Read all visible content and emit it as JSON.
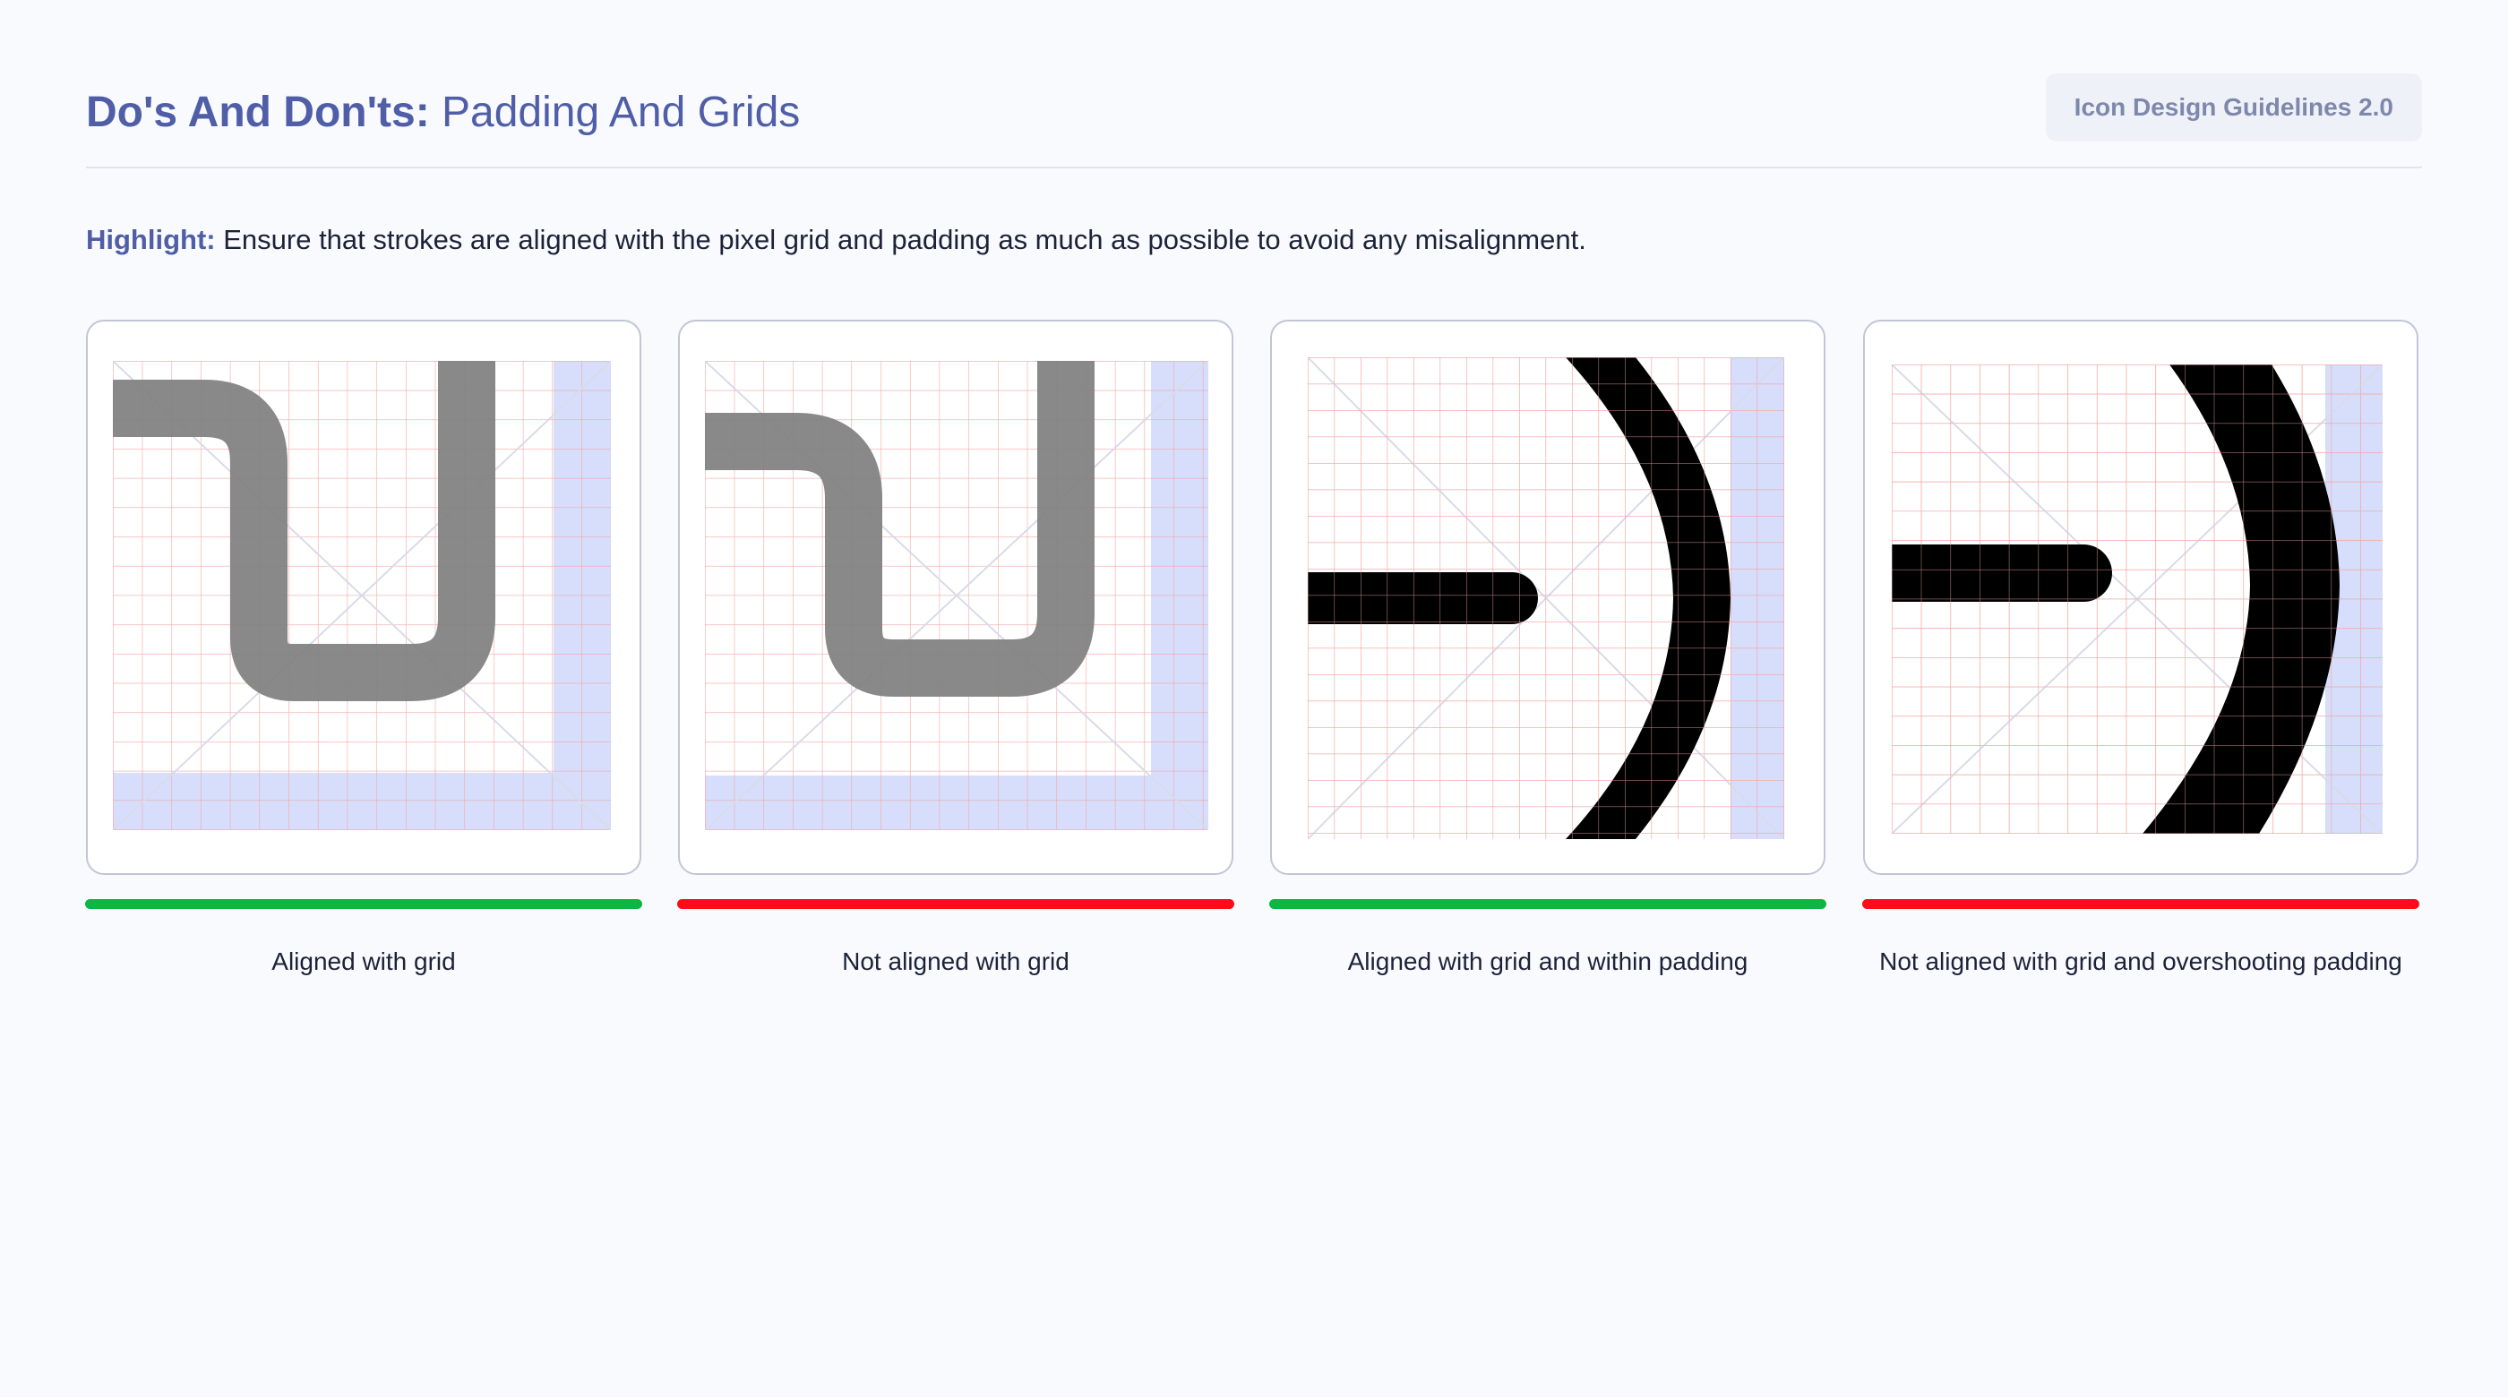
{
  "header": {
    "title_bold": "Do's And Don'ts:",
    "title_rest": " Padding And Grids",
    "badge": "Icon Design Guidelines 2.0"
  },
  "highlight": {
    "label": "Highlight:",
    "text": " Ensure that strokes are aligned with the pixel grid and padding as much as possible to avoid any misalignment."
  },
  "colors": {
    "good": "#0db543",
    "bad": "#ff0a19",
    "grid_line": "#f2a6a6",
    "padding": "#d6defc",
    "accent": "#4f5ea6"
  },
  "examples": [
    {
      "caption": "Aligned with grid",
      "status": "good",
      "icon": "hook-stroke-icon"
    },
    {
      "caption": "Not aligned with grid",
      "status": "bad",
      "icon": "hook-stroke-icon"
    },
    {
      "caption": "Aligned with grid and within padding",
      "status": "good",
      "icon": "arc-stroke-icon"
    },
    {
      "caption": "Not aligned with grid and overshooting padding",
      "status": "bad",
      "icon": "arc-stroke-icon"
    }
  ]
}
